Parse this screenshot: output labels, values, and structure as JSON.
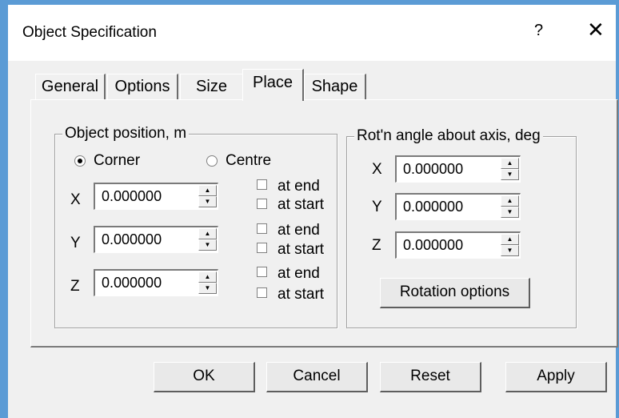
{
  "window": {
    "title": "Object Specification",
    "help": "?",
    "close": "✕"
  },
  "tabs": [
    {
      "label": "General"
    },
    {
      "label": "Options"
    },
    {
      "label": "Size"
    },
    {
      "label": "Place",
      "active": true
    },
    {
      "label": "Shape"
    }
  ],
  "position_group": {
    "legend": "Object position, m",
    "radio_corner": "Corner",
    "radio_centre": "Centre",
    "selected": "Corner",
    "rows": [
      {
        "axis": "X",
        "value": "0.000000",
        "at_end": "at end",
        "at_start": "at start"
      },
      {
        "axis": "Y",
        "value": "0.000000",
        "at_end": "at end",
        "at_start": "at start"
      },
      {
        "axis": "Z",
        "value": "0.000000",
        "at_end": "at end",
        "at_start": "at start"
      }
    ]
  },
  "rotation_group": {
    "legend": "Rot'n angle about axis, deg",
    "rows": [
      {
        "axis": "X",
        "value": "0.000000"
      },
      {
        "axis": "Y",
        "value": "0.000000"
      },
      {
        "axis": "Z",
        "value": "0.000000"
      }
    ],
    "options_button": "Rotation options"
  },
  "buttons": {
    "ok": "OK",
    "cancel": "Cancel",
    "reset": "Reset",
    "apply": "Apply"
  },
  "colors": {
    "accent_border": "#5b9bd5",
    "dialog_bg": "#f0f0f0"
  }
}
